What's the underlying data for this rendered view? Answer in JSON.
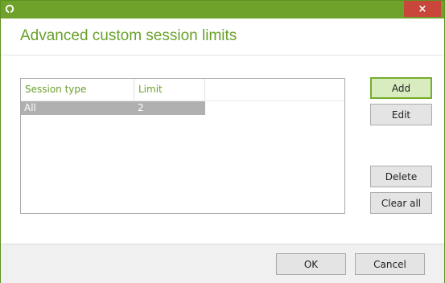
{
  "window": {
    "close_label": "×"
  },
  "header": {
    "title": "Advanced custom session limits"
  },
  "table": {
    "columns": [
      "Session type",
      "Limit"
    ],
    "rows": [
      {
        "session_type": "All",
        "limit": "2"
      }
    ]
  },
  "side_buttons": {
    "add": "Add",
    "edit": "Edit",
    "delete": "Delete",
    "clear_all": "Clear all"
  },
  "footer": {
    "ok": "OK",
    "cancel": "Cancel"
  },
  "colors": {
    "accent": "#6fa22a",
    "title_text": "#6aa12b",
    "close_button": "#c9463a",
    "selected_row": "#b0b0b0"
  },
  "icons": {
    "app": "app-logo-icon",
    "close": "close-icon"
  }
}
